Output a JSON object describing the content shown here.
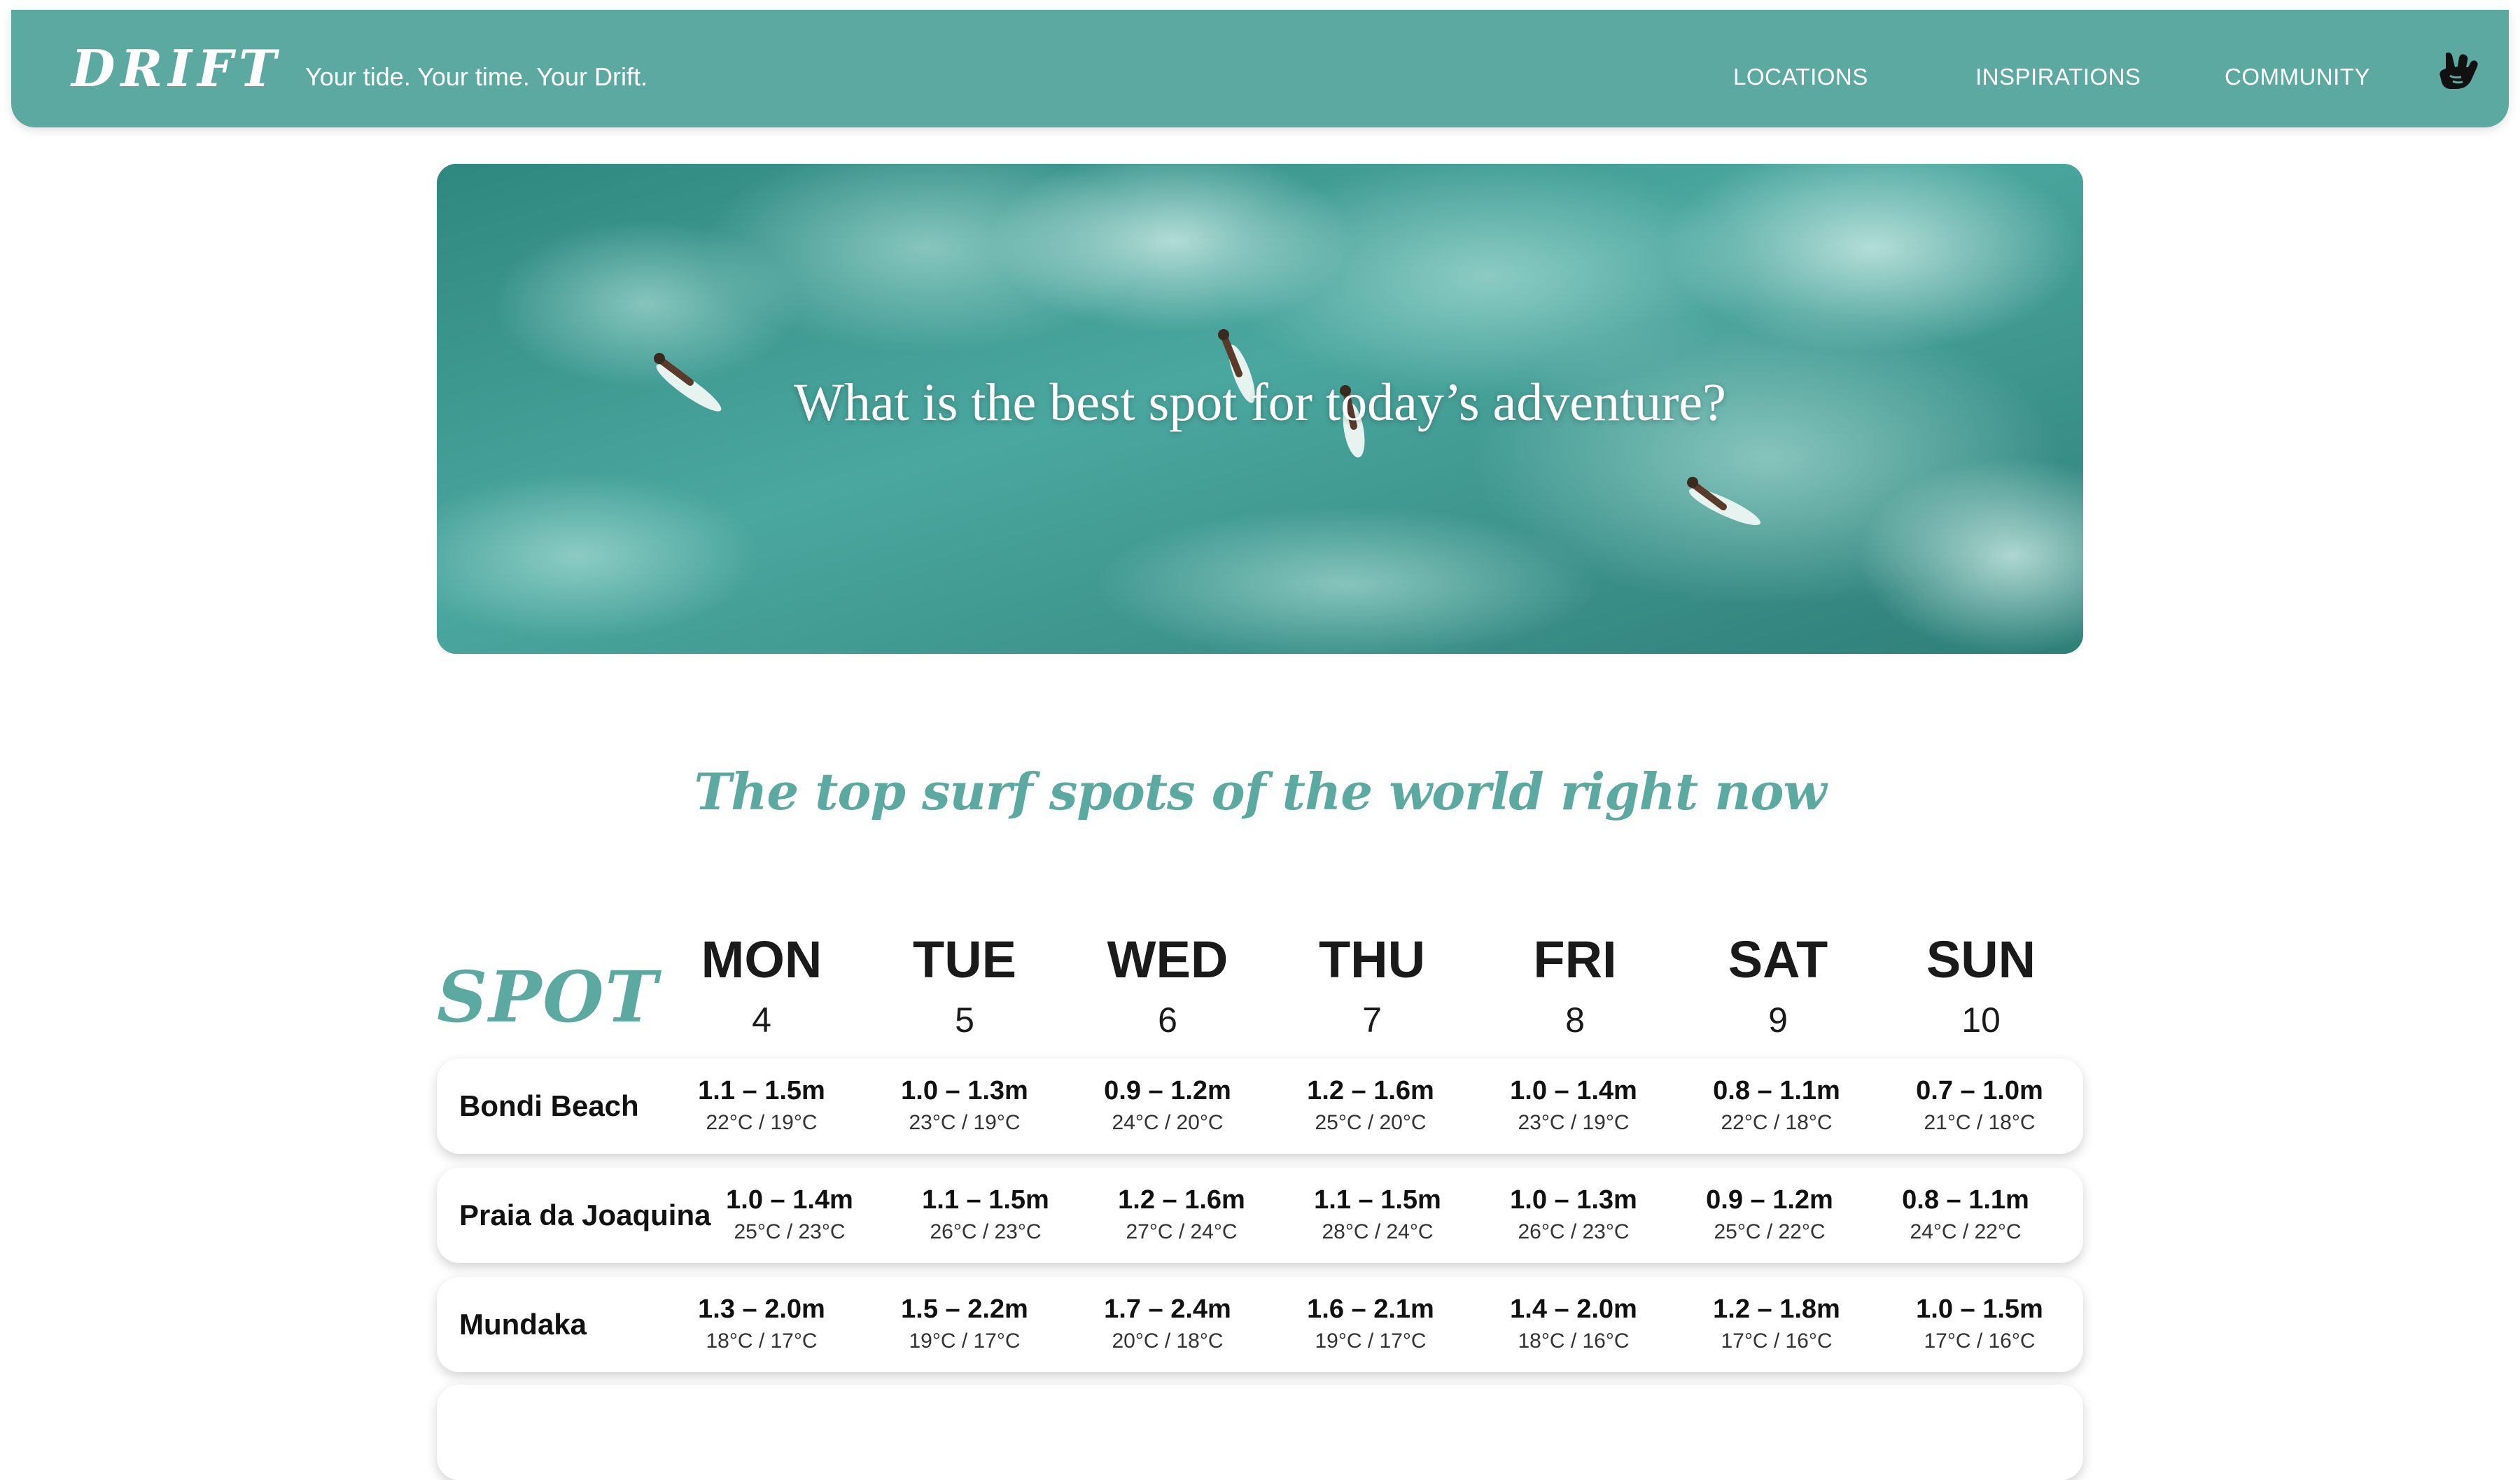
{
  "nav": {
    "logo": "DRIFT",
    "tagline": "Your tide. Your time. Your Drift.",
    "links": [
      "LOCATIONS",
      "INSPIRATIONS",
      "COMMUNITY"
    ],
    "profile_icon": "shaka-hand-icon"
  },
  "hero": {
    "title": "What is the best spot for today’s adventure?",
    "image": "aerial-surfers-turquoise-water"
  },
  "section": {
    "title": "The top surf spots of the world right now"
  },
  "table": {
    "spot_heading": "SPOT",
    "days": [
      {
        "name": "MON",
        "num": "4"
      },
      {
        "name": "TUE",
        "num": "5"
      },
      {
        "name": "WED",
        "num": "6"
      },
      {
        "name": "THU",
        "num": "7"
      },
      {
        "name": "FRI",
        "num": "8"
      },
      {
        "name": "SAT",
        "num": "9"
      },
      {
        "name": "SUN",
        "num": "10"
      }
    ],
    "rows": [
      {
        "name": "Bondi Beach",
        "cells": [
          {
            "wave": "1.1 – 1.5m",
            "temp": "22°C / 19°C"
          },
          {
            "wave": "1.0 – 1.3m",
            "temp": "23°C / 19°C"
          },
          {
            "wave": "0.9 – 1.2m",
            "temp": "24°C / 20°C"
          },
          {
            "wave": "1.2 – 1.6m",
            "temp": "25°C / 20°C"
          },
          {
            "wave": "1.0 – 1.4m",
            "temp": "23°C / 19°C"
          },
          {
            "wave": "0.8 – 1.1m",
            "temp": "22°C / 18°C"
          },
          {
            "wave": "0.7 – 1.0m",
            "temp": "21°C / 18°C"
          }
        ]
      },
      {
        "name": "Praia da Joaquina",
        "cells": [
          {
            "wave": "1.0 – 1.4m",
            "temp": "25°C / 23°C"
          },
          {
            "wave": "1.1 – 1.5m",
            "temp": "26°C / 23°C"
          },
          {
            "wave": "1.2 – 1.6m",
            "temp": "27°C / 24°C"
          },
          {
            "wave": "1.1 – 1.5m",
            "temp": "28°C / 24°C"
          },
          {
            "wave": "1.0 – 1.3m",
            "temp": "26°C / 23°C"
          },
          {
            "wave": "0.9 – 1.2m",
            "temp": "25°C / 22°C"
          },
          {
            "wave": "0.8 – 1.1m",
            "temp": "24°C / 22°C"
          }
        ]
      },
      {
        "name": "Mundaka",
        "cells": [
          {
            "wave": "1.3 – 2.0m",
            "temp": "18°C / 17°C"
          },
          {
            "wave": "1.5 – 2.2m",
            "temp": "19°C / 17°C"
          },
          {
            "wave": "1.7 – 2.4m",
            "temp": "20°C / 18°C"
          },
          {
            "wave": "1.6 – 2.1m",
            "temp": "19°C / 17°C"
          },
          {
            "wave": "1.4 – 2.0m",
            "temp": "18°C / 16°C"
          },
          {
            "wave": "1.2 – 1.8m",
            "temp": "17°C / 16°C"
          },
          {
            "wave": "1.0 – 1.5m",
            "temp": "17°C / 16°C"
          }
        ]
      }
    ]
  }
}
